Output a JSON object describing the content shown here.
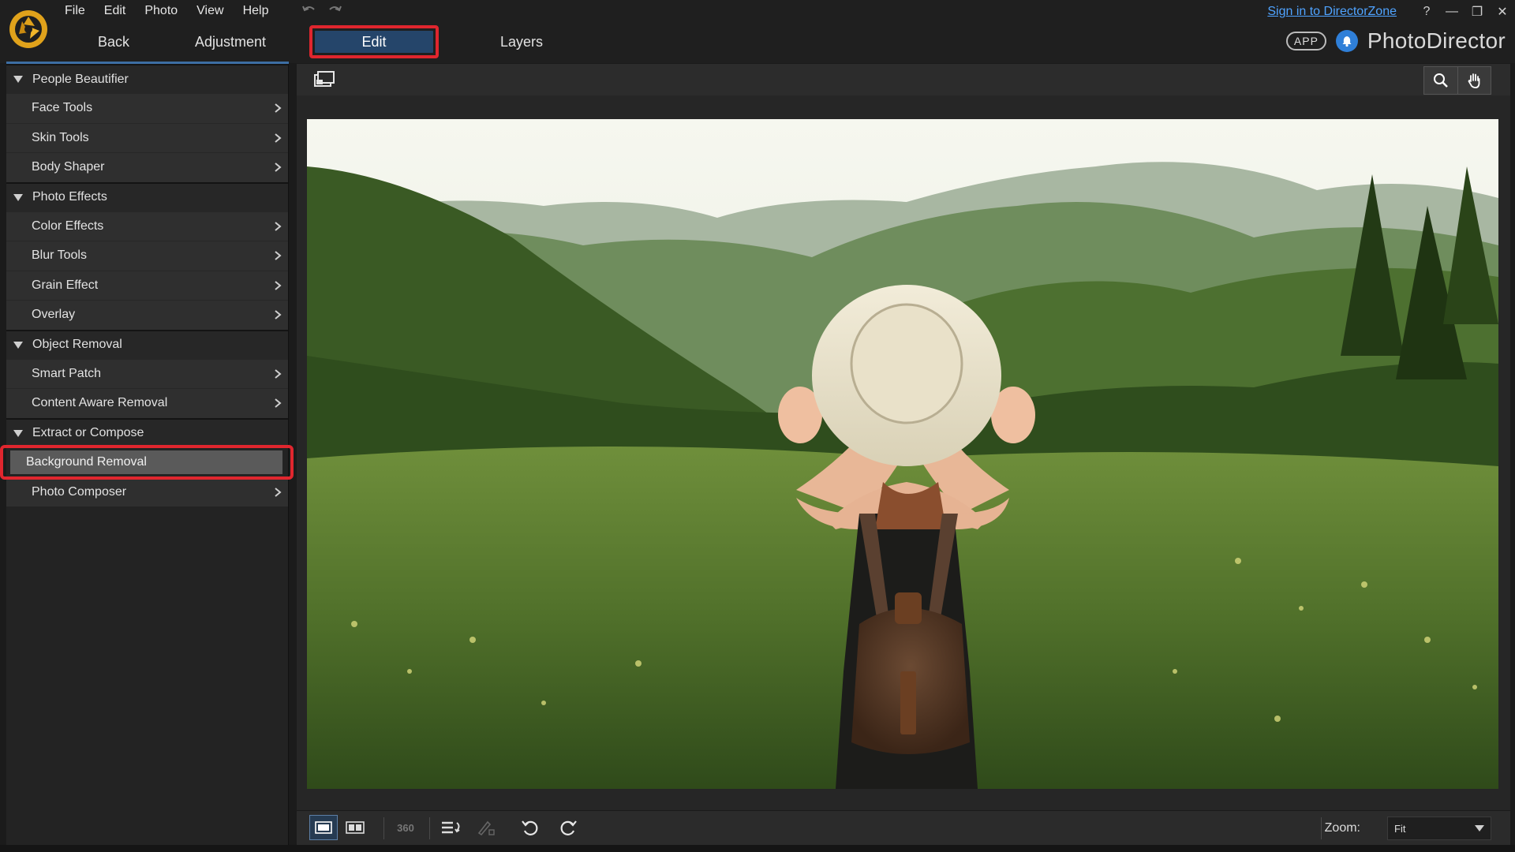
{
  "menu": [
    "File",
    "Edit",
    "Photo",
    "View",
    "Help"
  ],
  "topright": {
    "signin": "Sign in to DirectorZone",
    "help": "?",
    "minimize": "—",
    "restore": "❐",
    "close": "✕"
  },
  "nav": {
    "back": "Back",
    "adjustment": "Adjustment",
    "edit": "Edit",
    "layers": "Layers"
  },
  "brand": {
    "app_badge": "APP",
    "name": "PhotoDirector"
  },
  "sidebar": {
    "sections": [
      {
        "title": "People Beautifier",
        "items": [
          "Face Tools",
          "Skin Tools",
          "Body Shaper"
        ]
      },
      {
        "title": "Photo Effects",
        "items": [
          "Color Effects",
          "Blur Tools",
          "Grain Effect",
          "Overlay"
        ]
      },
      {
        "title": "Object Removal",
        "items": [
          "Smart Patch",
          "Content Aware Removal"
        ]
      },
      {
        "title": "Extract or Compose",
        "items": [
          "Background Removal",
          "Photo Composer"
        ]
      }
    ],
    "selected_item": "Background Removal"
  },
  "bottom": {
    "view_360": "360",
    "zoom_label": "Zoom:",
    "zoom_value": "Fit"
  },
  "colors": {
    "accent_blue": "#25456a",
    "highlight_red": "#e0262e",
    "link_blue": "#4fa3ff"
  },
  "icons": {
    "logo": "photodirector-logo",
    "undo": "undo-icon",
    "redo": "redo-icon",
    "bell": "notification-bell-icon",
    "compare": "compare-view-icon",
    "magnifier": "magnifier-icon",
    "hand": "hand-pan-icon"
  }
}
